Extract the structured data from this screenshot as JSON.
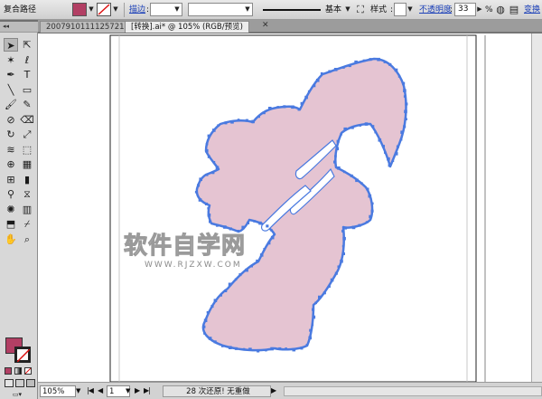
{
  "control_bar": {
    "object_type": "复合路径",
    "fill_color": "#b23f64",
    "stroke_label": "描边",
    "stroke_weight": "",
    "stroke_profile": "基本",
    "style_label": "样式",
    "opacity_label": "不透明度",
    "opacity_value": "33",
    "opacity_unit": "%",
    "transform_label": "变换"
  },
  "tabs": [
    {
      "label": "2007910111125721",
      "active": false
    },
    {
      "label": "[转换].ai* @ 105% (RGB/预览)",
      "active": true
    }
  ],
  "tool_icons": [
    "selection-tool",
    "direct-selection-tool",
    "magic-wand-tool",
    "lasso-tool",
    "pen-tool",
    "type-tool",
    "line-segment-tool",
    "rectangle-tool",
    "paintbrush-tool",
    "pencil-tool",
    "blob-brush-tool",
    "eraser-tool",
    "rotate-tool",
    "scale-tool",
    "warp-tool",
    "free-transform-tool",
    "shape-builder-tool",
    "perspective-grid-tool",
    "mesh-tool",
    "gradient-tool",
    "eyedropper-tool",
    "blend-tool",
    "symbol-sprayer-tool",
    "column-graph-tool",
    "artboard-tool",
    "slice-tool",
    "hand-tool",
    "zoom-tool"
  ],
  "fill_swatch_color": "#b23f64",
  "artwork": {
    "fill_color": "#e5c4d2",
    "point_color": "#4a7ae0",
    "watermark_main": "软件自学网",
    "watermark_sub": "WWW.RJZXW.COM"
  },
  "status_bar": {
    "zoom": "105%",
    "artboard_number": "1",
    "undo_info": "28 次还原! 无重做"
  }
}
